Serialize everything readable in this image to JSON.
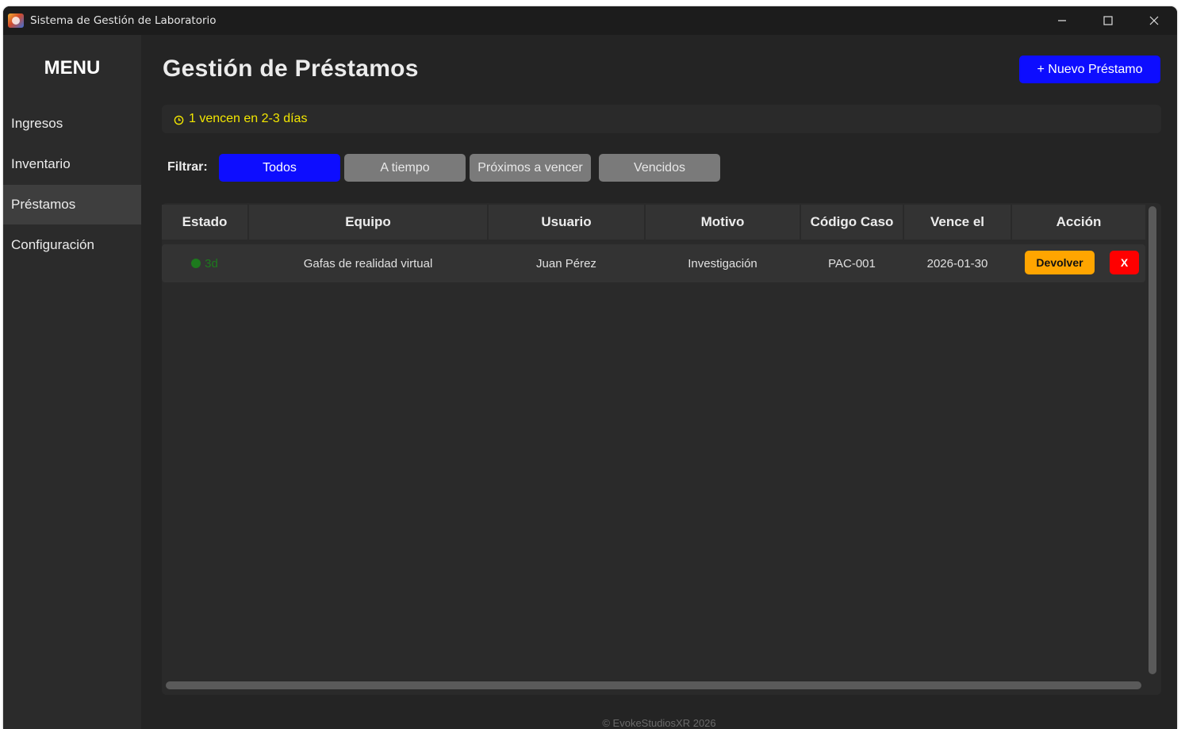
{
  "window": {
    "title": "Sistema de Gestión de Laboratorio"
  },
  "sidebar": {
    "title": "MENU",
    "items": [
      {
        "label": "Ingresos",
        "active": false
      },
      {
        "label": "Inventario",
        "active": false
      },
      {
        "label": "Préstamos",
        "active": true
      },
      {
        "label": "Configuración",
        "active": false
      }
    ]
  },
  "main": {
    "title": "Gestión de Préstamos",
    "new_button": "+ Nuevo Préstamo",
    "alert": {
      "icon": "clock-icon",
      "text": "1 vencen en 2-3 días",
      "color": "#f2e600"
    },
    "filter": {
      "label": "Filtrar:",
      "options": [
        "Todos",
        "A tiempo",
        "Próximos a vencer",
        "Vencidos"
      ],
      "selected": "Todos"
    },
    "table": {
      "columns": [
        "Estado",
        "Equipo",
        "Usuario",
        "Motivo",
        "Código Caso",
        "Vence el",
        "Acción"
      ],
      "rows": [
        {
          "estado": "3d",
          "equipo": "Gafas de realidad virtual",
          "usuario": "Juan Pérez",
          "motivo": "Investigación",
          "codigo": "PAC-001",
          "vence": "2026-01-30",
          "return_label": "Devolver",
          "delete_label": "X"
        }
      ]
    }
  },
  "footer": "© EvokeStudiosXR 2026",
  "colors": {
    "accent": "#0d0dff",
    "return_button": "#ffa500",
    "delete_button": "#ff0000",
    "status_ok": "#1d7a1d"
  }
}
